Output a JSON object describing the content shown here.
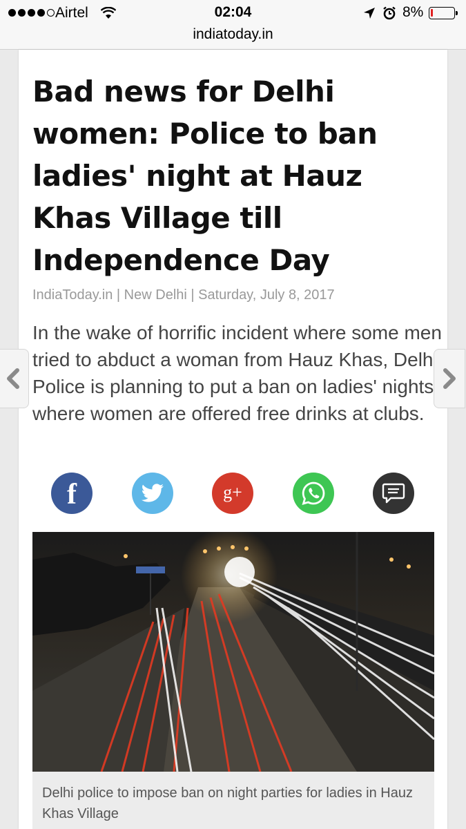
{
  "status_bar": {
    "carrier": "Airtel",
    "time": "02:04",
    "battery": "8%",
    "icons": [
      "signal-dots-icon",
      "wifi-icon",
      "location-arrow-icon",
      "alarm-clock-icon",
      "battery-icon"
    ],
    "battery_level": 0.08
  },
  "browser": {
    "url": "indiatoday.in"
  },
  "article": {
    "headline": "Bad news for Delhi women: Police to ban ladies' night at Hauz Khas Village till Independence Day",
    "byline": "IndiaToday.in | New Delhi | Saturday, July 8, 2017",
    "summary": "In the wake of horrific incident where some men tried to abduct a woman from Hauz Khas, Delhi Police is planning to put a ban on ladies' nights where women are offered free drinks at clubs.",
    "caption": "Delhi police to impose ban on night parties for ladies in Hauz Khas Village"
  },
  "share": {
    "items": [
      {
        "name": "facebook",
        "glyph": "f",
        "color": "#3b5998"
      },
      {
        "name": "twitter",
        "color": "#5eb7e8"
      },
      {
        "name": "google-plus",
        "glyph": "g+",
        "color": "#d33a2b"
      },
      {
        "name": "whatsapp",
        "color": "#3ec653"
      },
      {
        "name": "comment",
        "color": "#333333"
      }
    ]
  },
  "nav": {
    "prev_icon": "chevron-left-icon",
    "next_icon": "chevron-right-icon"
  }
}
